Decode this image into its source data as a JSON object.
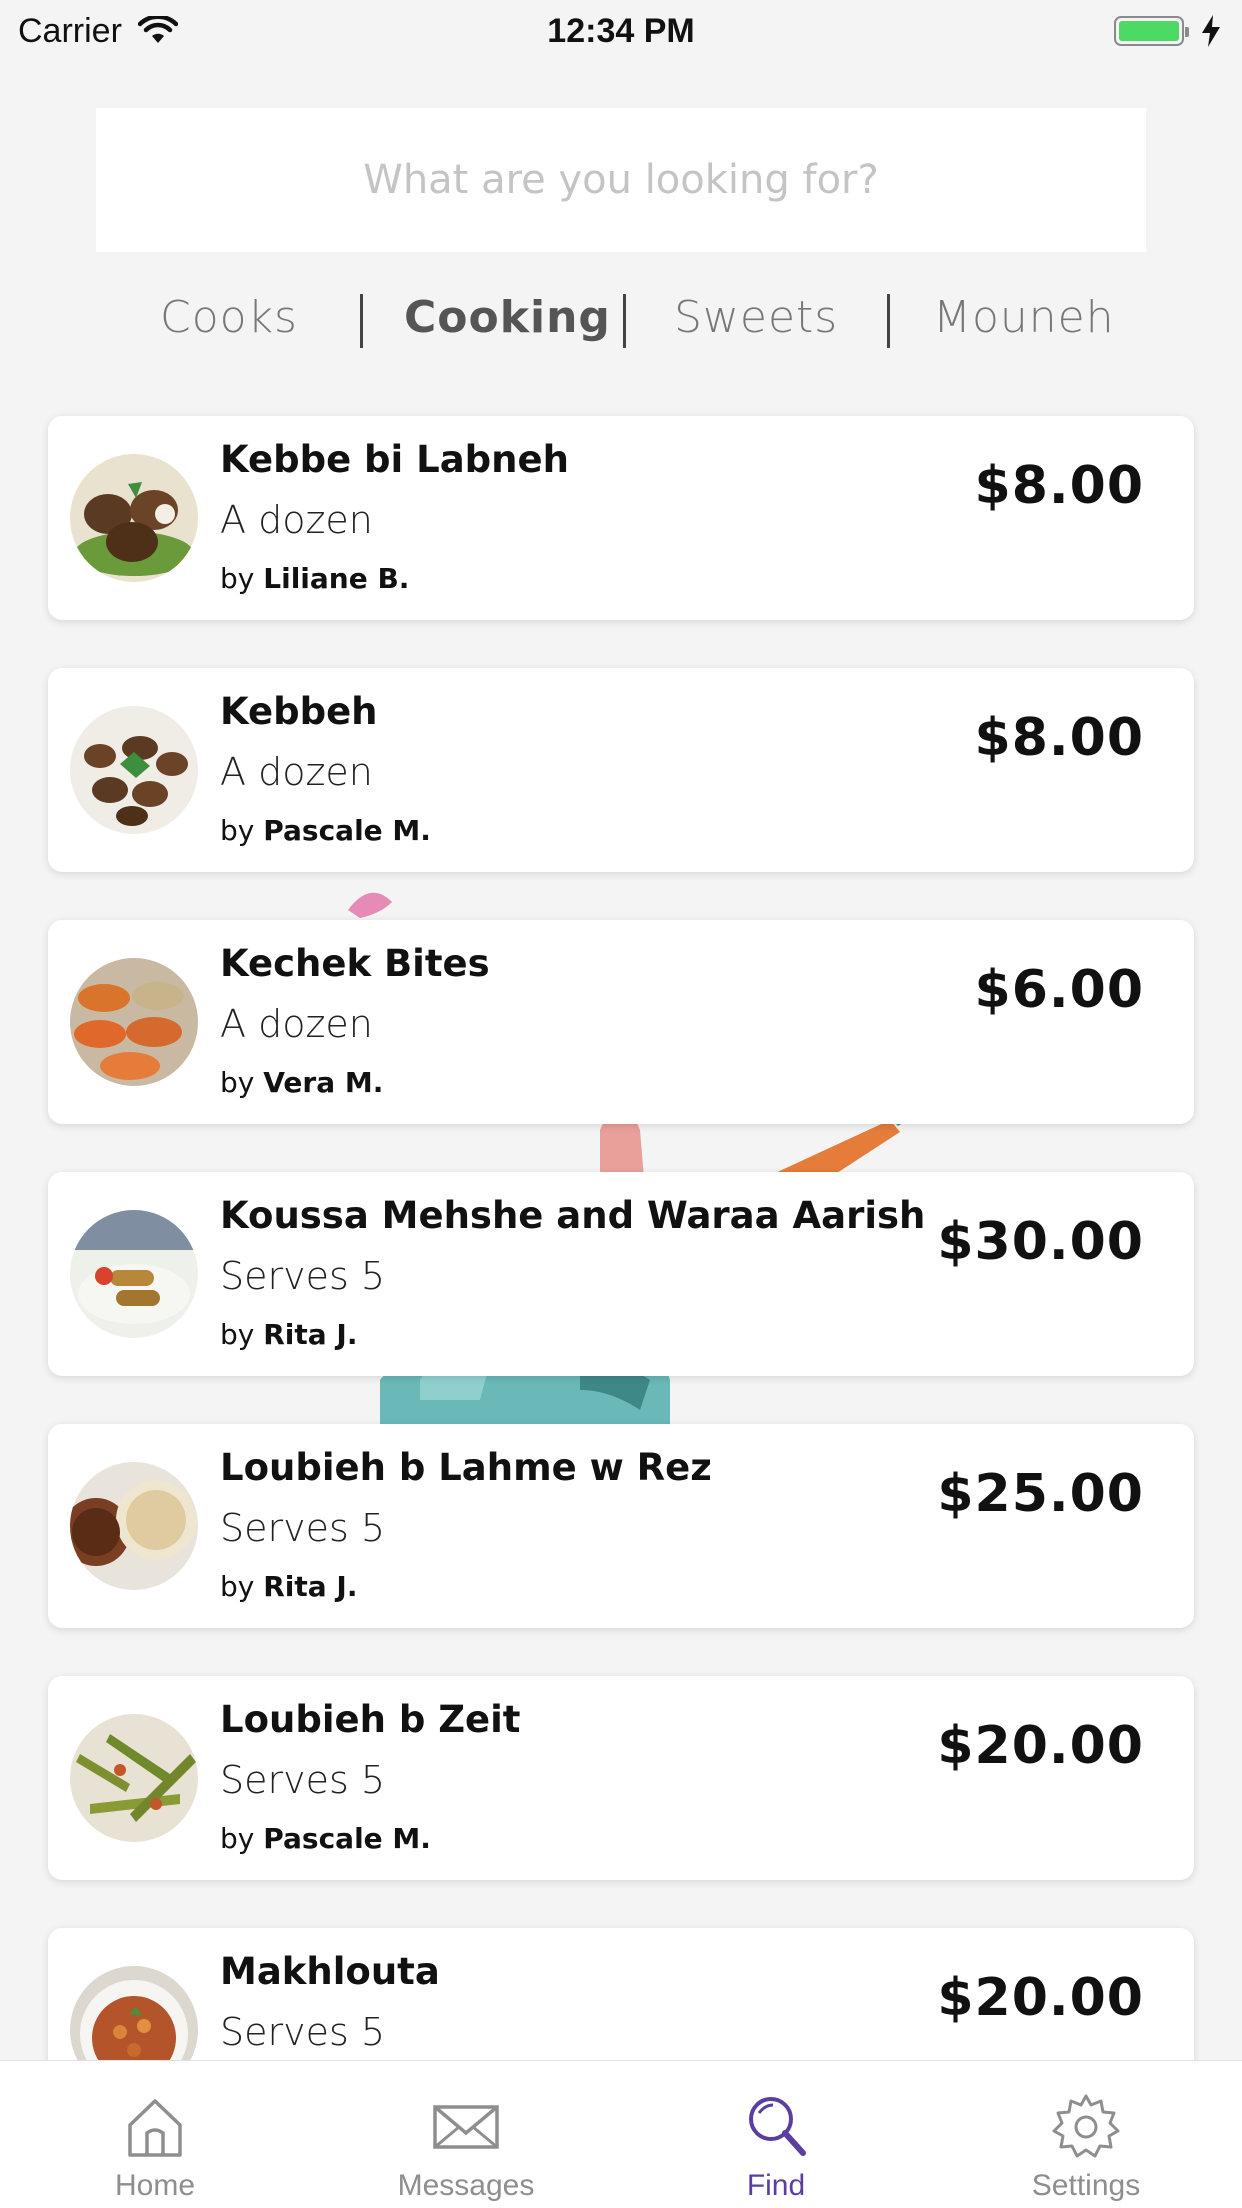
{
  "status_bar": {
    "carrier": "Carrier",
    "time": "12:34 PM"
  },
  "search": {
    "placeholder": "What are you looking for?"
  },
  "categories": [
    {
      "label": "Cooks"
    },
    {
      "label": "Cooking"
    },
    {
      "label": "Sweets"
    },
    {
      "label": "Mouneh"
    }
  ],
  "dishes": [
    {
      "name": "Kebbe bi Labneh",
      "quantity": "A dozen",
      "by_prefix": "by",
      "cook": "Liliane B.",
      "price": "$8.00"
    },
    {
      "name": "Kebbeh",
      "quantity": "A dozen",
      "by_prefix": "by",
      "cook": "Pascale M.",
      "price": "$8.00"
    },
    {
      "name": "Kechek Bites",
      "quantity": "A dozen",
      "by_prefix": "by",
      "cook": "Vera M.",
      "price": "$6.00"
    },
    {
      "name": "Koussa  Mehshe and Waraa Aarish",
      "quantity": "Serves 5",
      "by_prefix": "by",
      "cook": "Rita J.",
      "price": "$30.00"
    },
    {
      "name": "Loubieh b Lahme w Rez",
      "quantity": "Serves 5",
      "by_prefix": "by",
      "cook": "Rita J.",
      "price": "$25.00"
    },
    {
      "name": "Loubieh b Zeit",
      "quantity": "Serves 5",
      "by_prefix": "by",
      "cook": "Pascale M.",
      "price": "$20.00"
    },
    {
      "name": "Makhlouta",
      "quantity": "Serves 5",
      "price": "$20.00"
    }
  ],
  "tabbar": [
    {
      "label": "Home",
      "icon": "home-icon"
    },
    {
      "label": "Messages",
      "icon": "envelope-icon"
    },
    {
      "label": "Find",
      "icon": "search-icon"
    },
    {
      "label": "Settings",
      "icon": "gear-icon"
    }
  ],
  "colors": {
    "accent": "#5a3fa0",
    "battery": "#4cd964",
    "inactive_tab": "#8e8e8e"
  }
}
